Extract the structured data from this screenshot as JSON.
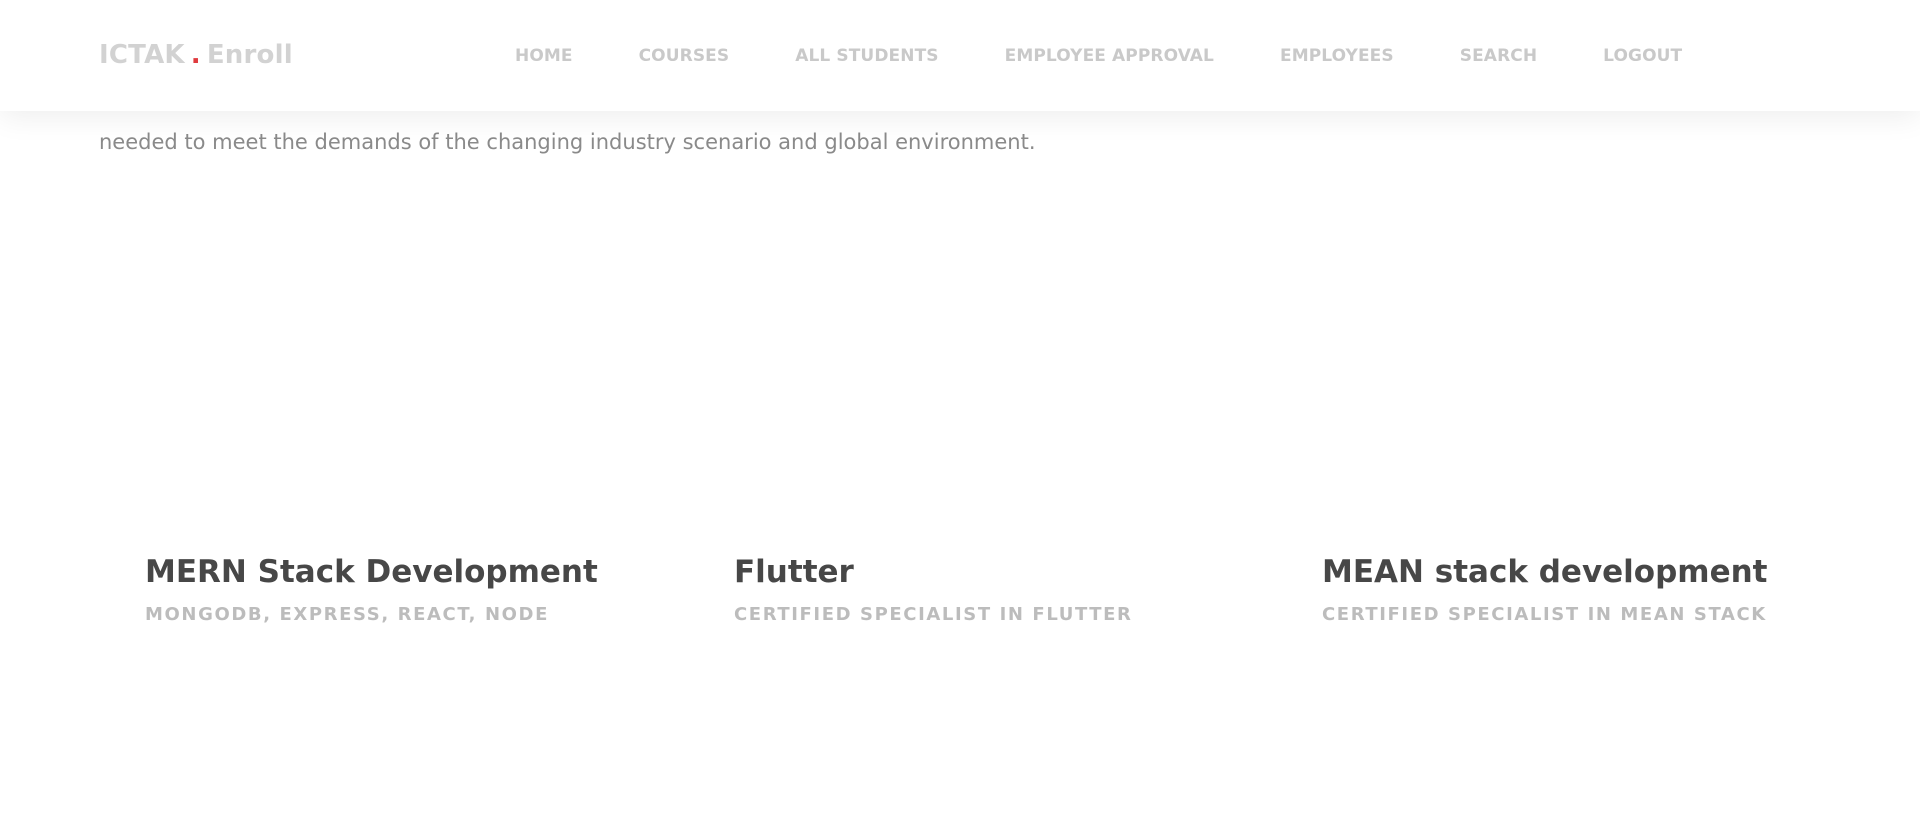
{
  "header": {
    "brand_left": "ICTAK",
    "brand_dot": ".",
    "brand_right": "Enroll",
    "nav": [
      {
        "label": "HOME"
      },
      {
        "label": "COURSES"
      },
      {
        "label": "ALL STUDENTS"
      },
      {
        "label": "EMPLOYEE APPROVAL"
      },
      {
        "label": "EMPLOYEES"
      },
      {
        "label": "SEARCH"
      },
      {
        "label": "LOGOUT"
      }
    ]
  },
  "intro": {
    "visible_line": "needed to meet the demands of the changing industry scenario and global environment."
  },
  "courses": [
    {
      "title": "MERN Stack Development",
      "subtitle": "MONGODB, EXPRESS, REACT, NODE"
    },
    {
      "title": "Flutter",
      "subtitle": "CERTIFIED SPECIALIST IN FLUTTER"
    },
    {
      "title": "MEAN stack development",
      "subtitle": "CERTIFIED SPECIALIST IN MEAN STACK"
    }
  ],
  "colors": {
    "accent_dot": "#e03a3e",
    "nav_text": "#c9c9c9",
    "title_text": "#474747",
    "subtitle_text": "#bcbcbc"
  }
}
